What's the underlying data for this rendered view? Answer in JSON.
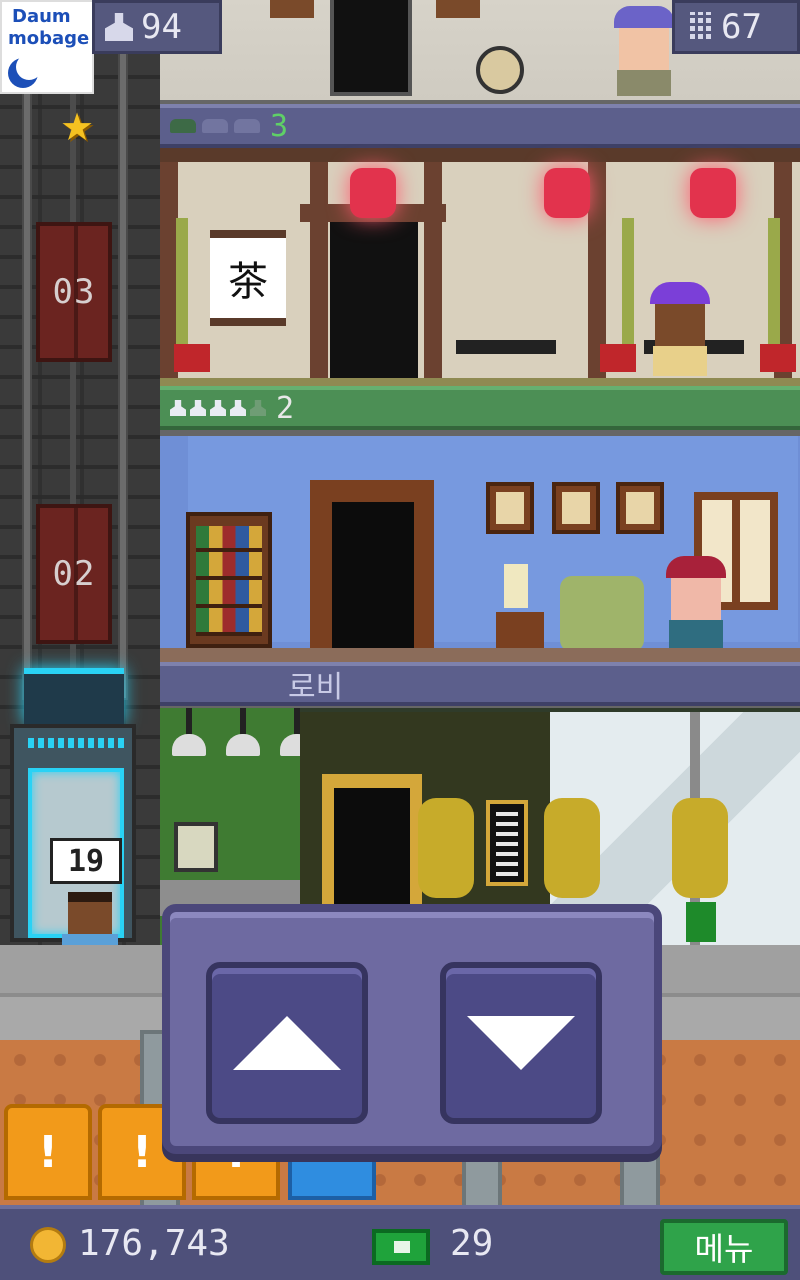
{
  "hud": {
    "population": "94",
    "floors": "67"
  },
  "badge": {
    "line1": "Daum",
    "line2": "mobage"
  },
  "shaft": {
    "floor_labels": [
      "03",
      "02"
    ],
    "elevator_passenger_floor": "19"
  },
  "tower": {
    "tea_floor": {
      "label": "3",
      "scroll_text": "茶",
      "stock_icons": 3,
      "stock_filled": 1
    },
    "apartment_floor": {
      "label": "2",
      "residents_icons": 5,
      "residents_filled": 4
    },
    "lobby": {
      "label": "로비"
    }
  },
  "controls": {
    "up_label": "up",
    "down_label": "down"
  },
  "alerts": [
    "!",
    "!",
    "!"
  ],
  "bottom": {
    "coins": "176,743",
    "bux": "29",
    "menu_label": "메뉴"
  },
  "colors": {
    "panel": "#6e6aa1",
    "accent_cyan": "#29d2f5",
    "menu_green": "#2fa34a",
    "alert_orange": "#f29a1a",
    "alert_blue": "#2f8de0"
  },
  "icons": [
    "person-icon",
    "building-icon",
    "star-icon",
    "coin-icon",
    "bux-icon",
    "up-arrow-icon",
    "down-arrow-icon"
  ]
}
